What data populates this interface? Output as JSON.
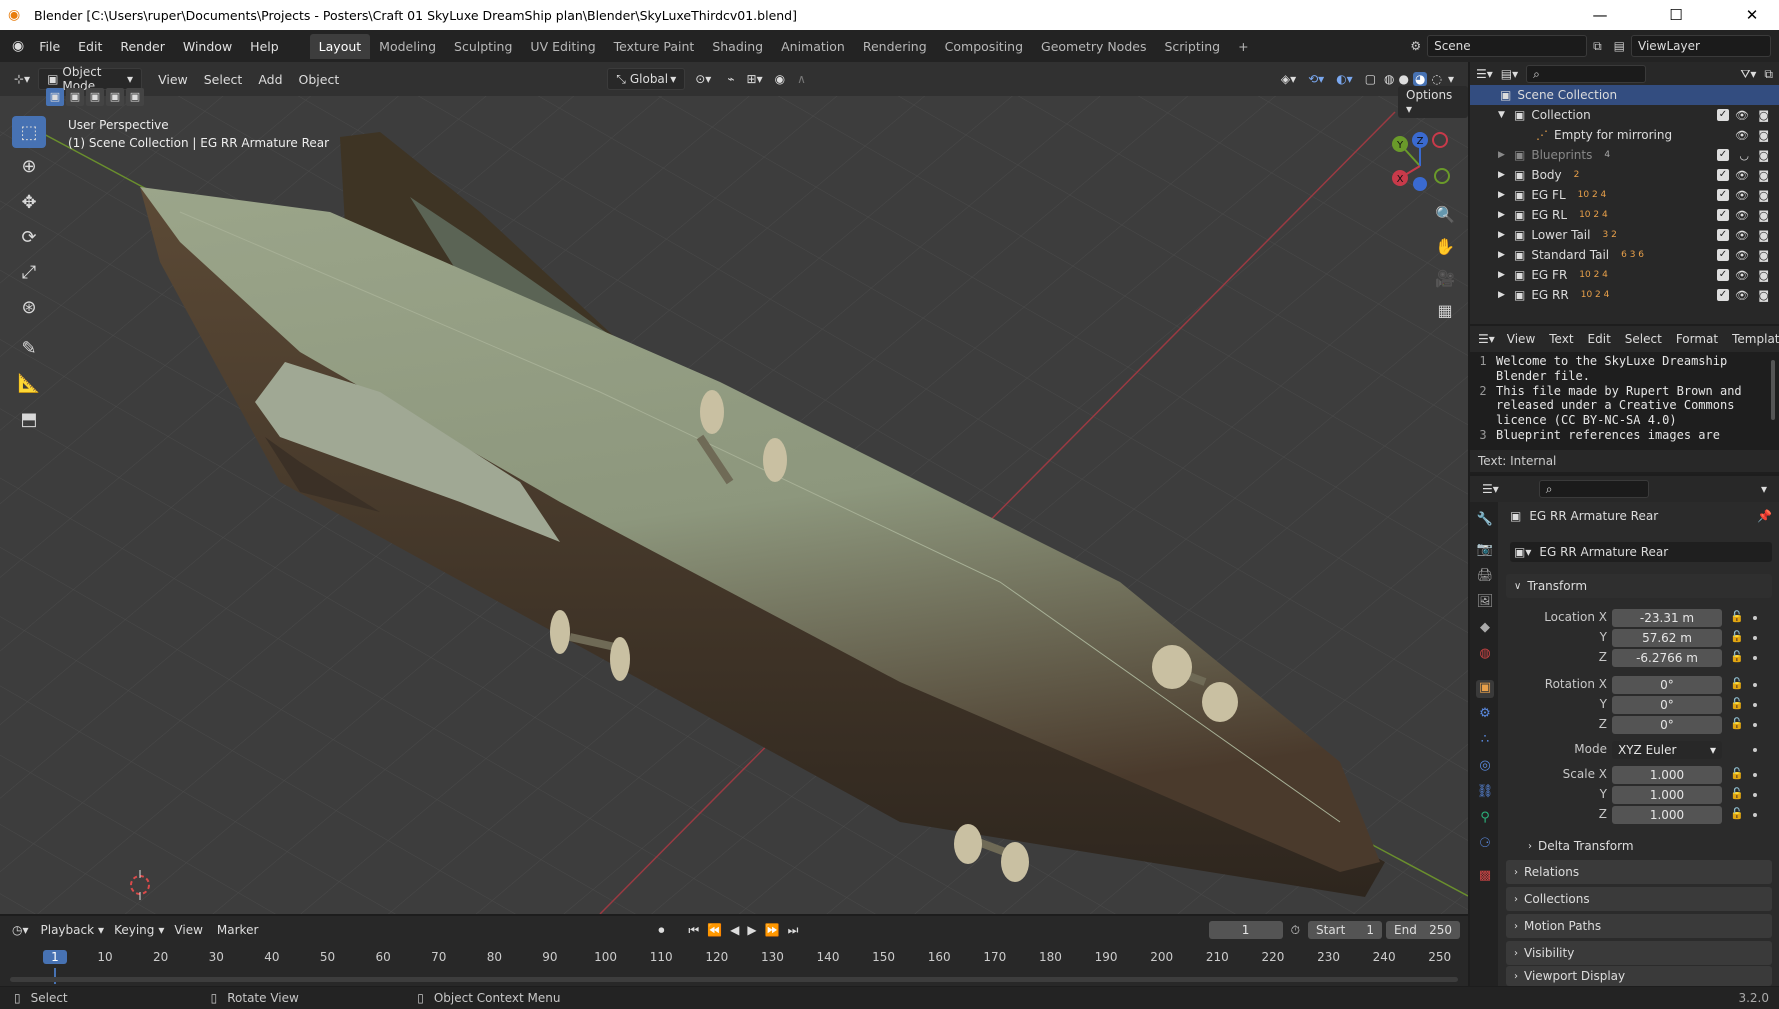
{
  "window": {
    "title": "Blender [C:\\Users\\ruper\\Documents\\Projects - Posters\\Craft 01 SkyLuxe DreamShip plan\\Blender\\SkyLuxeThirdcv01.blend]",
    "minimize": "—",
    "maximize": "☐",
    "close": "✕"
  },
  "menubar": {
    "menus": [
      "File",
      "Edit",
      "Render",
      "Window",
      "Help"
    ],
    "workspaces": [
      "Layout",
      "Modeling",
      "Sculpting",
      "UV Editing",
      "Texture Paint",
      "Shading",
      "Animation",
      "Rendering",
      "Compositing",
      "Geometry Nodes",
      "Scripting"
    ],
    "add_workspace": "+",
    "scene": "Scene",
    "view_layer": "ViewLayer"
  },
  "viewport": {
    "mode": "Object Mode",
    "menus": [
      "View",
      "Select",
      "Add",
      "Object"
    ],
    "orientation": "Global",
    "options": "Options",
    "info_line1": "User Perspective",
    "info_line2": "(1) Scene Collection | EG RR Armature Rear",
    "gizmo": {
      "x": "X",
      "y": "Y",
      "z": "Z"
    }
  },
  "outliner": {
    "root": "Scene Collection",
    "items": [
      {
        "name": "Collection",
        "badges": ""
      },
      {
        "name": "Empty for mirroring",
        "badges": ""
      },
      {
        "name": "Blueprints",
        "badges": "4"
      },
      {
        "name": "Body",
        "badges": "2"
      },
      {
        "name": "EG FL",
        "badges": "10 2 4"
      },
      {
        "name": "EG RL",
        "badges": "10 2 4"
      },
      {
        "name": "Lower Tail",
        "badges": "3 2"
      },
      {
        "name": "Standard Tail",
        "badges": "6 3 6"
      },
      {
        "name": "EG FR",
        "badges": "10 2 4"
      },
      {
        "name": "EG RR",
        "badges": "10 2 4"
      }
    ]
  },
  "text_editor": {
    "menus": [
      "View",
      "Text",
      "Edit",
      "Select",
      "Format",
      "Templates"
    ],
    "lines": [
      {
        "num": "1",
        "text": "Welcome to the SkyLuxe Dreamship"
      },
      {
        "num": "",
        "text": "Blender file."
      },
      {
        "num": "2",
        "text": "This file made by Rupert Brown and"
      },
      {
        "num": "",
        "text": "released under a Creative Commons"
      },
      {
        "num": "",
        "text": "licence (CC BY-NC-SA 4.0)"
      },
      {
        "num": "3",
        "text": "Blueprint references images are"
      }
    ],
    "footer": "Text: Internal"
  },
  "properties": {
    "object_name": "EG RR Armature Rear",
    "object_field": "EG RR Armature Rear",
    "transform_title": "Transform",
    "location_label": "Location X",
    "location": {
      "x": "-23.31 m",
      "y": "57.62 m",
      "z": "-6.2766 m"
    },
    "rotation_label": "Rotation X",
    "rotation": {
      "x": "0°",
      "y": "0°",
      "z": "0°"
    },
    "mode_label": "Mode",
    "mode_value": "XYZ Euler",
    "scale_label": "Scale X",
    "scale": {
      "x": "1.000",
      "y": "1.000",
      "z": "1.000"
    },
    "axis_y": "Y",
    "axis_z": "Z",
    "delta_transform": "Delta Transform",
    "panels": [
      "Relations",
      "Collections",
      "Motion Paths",
      "Visibility",
      "Viewport Display"
    ]
  },
  "timeline": {
    "menus": [
      "Playback",
      "Keying",
      "View",
      "Marker"
    ],
    "current_frame": "1",
    "start_label": "Start",
    "start": "1",
    "end_label": "End",
    "end": "250",
    "ticks": [
      "1",
      "10",
      "20",
      "30",
      "40",
      "50",
      "60",
      "70",
      "80",
      "90",
      "100",
      "110",
      "120",
      "130",
      "140",
      "150",
      "160",
      "170",
      "180",
      "190",
      "200",
      "210",
      "220",
      "230",
      "240",
      "250"
    ]
  },
  "statusbar": {
    "select": "Select",
    "rotate": "Rotate View",
    "context": "Object Context Menu",
    "version": "3.2.0"
  }
}
